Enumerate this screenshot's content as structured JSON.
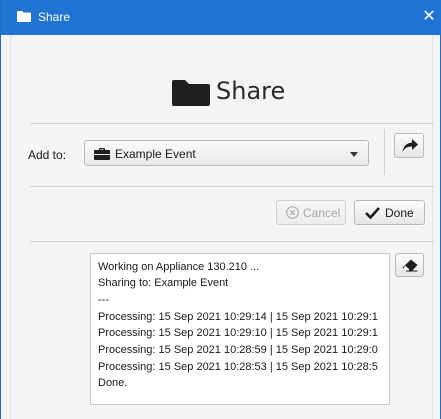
{
  "window": {
    "title": "Share",
    "close_glyph": "✕",
    "title_icon": "folder-icon",
    "accent_color": "#1e74d0"
  },
  "header": {
    "title": "Share",
    "icon": "folder-icon"
  },
  "add_to": {
    "label": "Add to:",
    "selected": "Example Event",
    "icon": "briefcase-icon",
    "share_button_icon": "share-arrow-icon"
  },
  "actions": {
    "cancel_label": "Cancel",
    "cancel_enabled": false,
    "cancel_icon": "cancel-circle-icon",
    "done_label": "Done",
    "done_icon": "checkmark-icon"
  },
  "log": {
    "lines": [
      "Working on Appliance 130.210 ...",
      "Sharing to: Example Event",
      "---",
      "Processing: 15 Sep 2021 10:29:14 | 15 Sep 2021 10:29:1",
      "Processing: 15 Sep 2021 10:29:10 | 15 Sep 2021 10:29:1",
      "Processing: 15 Sep 2021 10:28:59 | 15 Sep 2021 10:29:0",
      "Processing: 15 Sep 2021 10:28:53 | 15 Sep 2021 10:28:5",
      "Done."
    ],
    "clear_icon": "eraser-icon"
  }
}
